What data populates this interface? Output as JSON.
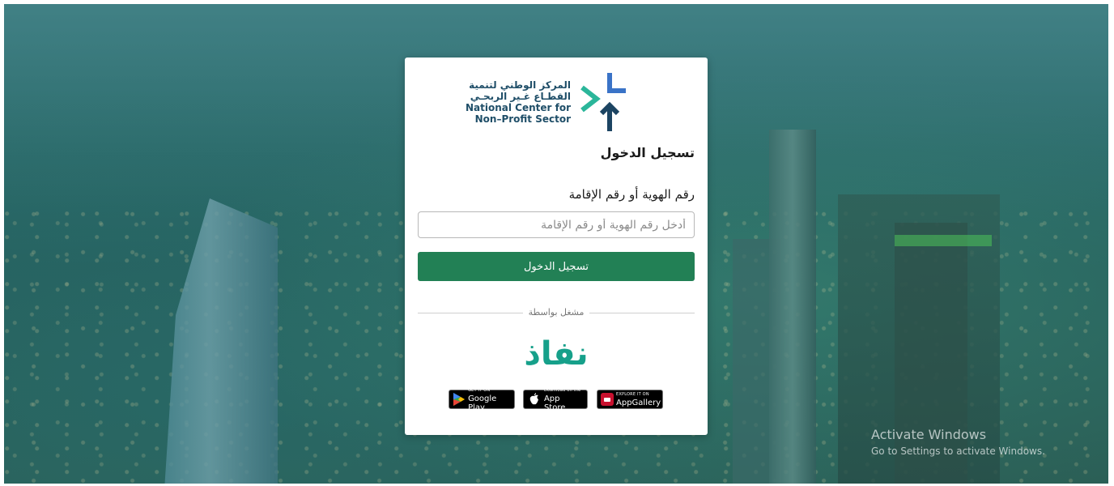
{
  "logo": {
    "arabic_line1": "المركز الوطني لتنمية",
    "arabic_line2": "القطـاع غـير الربحـي",
    "english_line1": "National Center for",
    "english_line2": "Non–Profit Sector",
    "mark_icon": "ncnp-arrows-logo-icon",
    "colors": {
      "teal": "#2bb69a",
      "blue": "#3a73c7",
      "navy": "#1c4462"
    }
  },
  "login": {
    "title": "تسجيل الدخول",
    "id_label": "رقم الهوية أو رقم الإقامة",
    "id_placeholder": "أدخل رقم الهوية أو رقم الإقامة",
    "id_value": "",
    "submit_label": "تسجيل الدخول",
    "submit_color": "#228055"
  },
  "provider": {
    "operated_by": "مشغل بواسطة",
    "name": "نفاذ",
    "name_color": "#16a08a"
  },
  "stores": [
    {
      "small": "GET IT ON",
      "big": "Google Play",
      "icon": "google-play-icon"
    },
    {
      "small": "Download on the",
      "big": "App Store",
      "icon": "apple-icon"
    },
    {
      "small": "EXPLORE IT ON",
      "big": "AppGallery",
      "icon": "huawei-appgallery-icon"
    }
  ],
  "watermark": {
    "title": "Activate Windows",
    "subtitle": "Go to Settings to activate Windows."
  }
}
